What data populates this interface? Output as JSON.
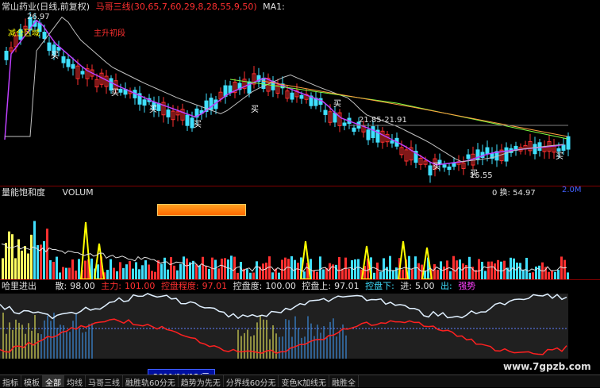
{
  "main": {
    "title": "常山药业(日线,前复权)",
    "indicator": "马哥三线(30,65,7,60,29,8,28,55,9,50)",
    "indicator_ma": "MA1:",
    "price_high_label": "26.97",
    "tag_sell_left": "减仓区域",
    "tag_rise": "主升初段",
    "range_label": "21.85-21.91",
    "low_label": "15.55",
    "buy_text": "买"
  },
  "vol": {
    "left_label": "量能饱和度",
    "name": "VOLUM",
    "turnover_label": "0 换: 54.97",
    "right_tag": "2.0M"
  },
  "osc": {
    "items": [
      {
        "k": "哈里进出",
        "v": ""
      },
      {
        "k": "散:",
        "v": "98.00"
      },
      {
        "k": "主力:",
        "v": "101.00"
      },
      {
        "k": "控盘程度:",
        "v": "97.01"
      },
      {
        "k": "控盘度:",
        "v": "100.00"
      },
      {
        "k": "控盘上:",
        "v": "97.01"
      },
      {
        "k": "控盘下:",
        "v": ""
      },
      {
        "k": "进:",
        "v": "5.00"
      },
      {
        "k": "出:",
        "v": ""
      },
      {
        "k": "强势",
        "v": ""
      }
    ]
  },
  "date_label": "2011/10/12/三",
  "watermark": "www.7gpzb.com",
  "tabs": [
    "指标",
    "模板",
    "全部",
    "均线",
    "马哥三线",
    "融胜轨60分无",
    "趋势为先无",
    "分界线60分无",
    "变色K加线无",
    "融胜全"
  ],
  "colors": {
    "up": "#ff3030",
    "down": "#40e0ff",
    "ma_white": "#c0c0c0",
    "ma_purple": "#c040ff"
  }
}
